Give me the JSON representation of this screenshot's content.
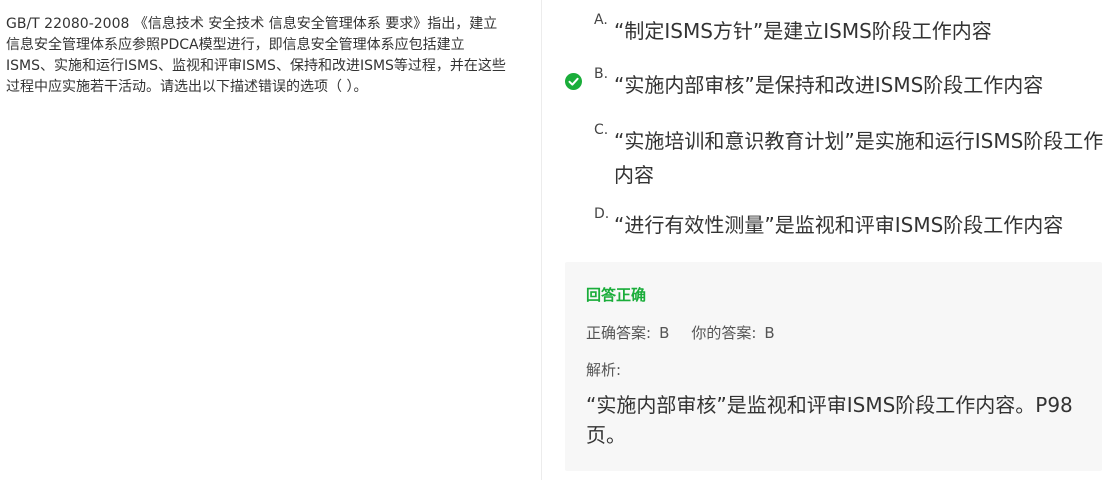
{
  "question": {
    "text": "GB/T 22080-2008 《信息技术 安全技术 信息安全管理体系 要求》指出，建立信息安全管理体系应参照PDCA模型进行，即信息安全管理体系应包括建立ISMS、实施和运行ISMS、监视和评审ISMS、保持和改进ISMS等过程，并在这些过程中应实施若干活动。请选出以下描述错误的选项（ ）。"
  },
  "options": [
    {
      "letter": "A.",
      "text": "“制定ISMS方针”是建立ISMS阶段工作内容"
    },
    {
      "letter": "B.",
      "text": "“实施内部审核”是保持和改进ISMS阶段工作内容"
    },
    {
      "letter": "C.",
      "text": "“实施培训和意识教育计划”是实施和运行ISMS阶段工作内容"
    },
    {
      "letter": "D.",
      "text": "“进行有效性测量”是监视和评审ISMS阶段工作内容"
    }
  ],
  "selected_icon": "check-circle-icon",
  "answer_panel": {
    "result": "回答正确",
    "correct_label": "正确答案:",
    "correct_value": "B",
    "yours_label": "你的答案:",
    "yours_value": "B",
    "analysis_label": "解析:",
    "analysis_text": "“实施内部审核”是监视和评审ISMS阶段工作内容。P98页。"
  },
  "colors": {
    "correct_green": "#1aad3a",
    "panel_bg": "#f7f7f7",
    "text": "#333333"
  }
}
